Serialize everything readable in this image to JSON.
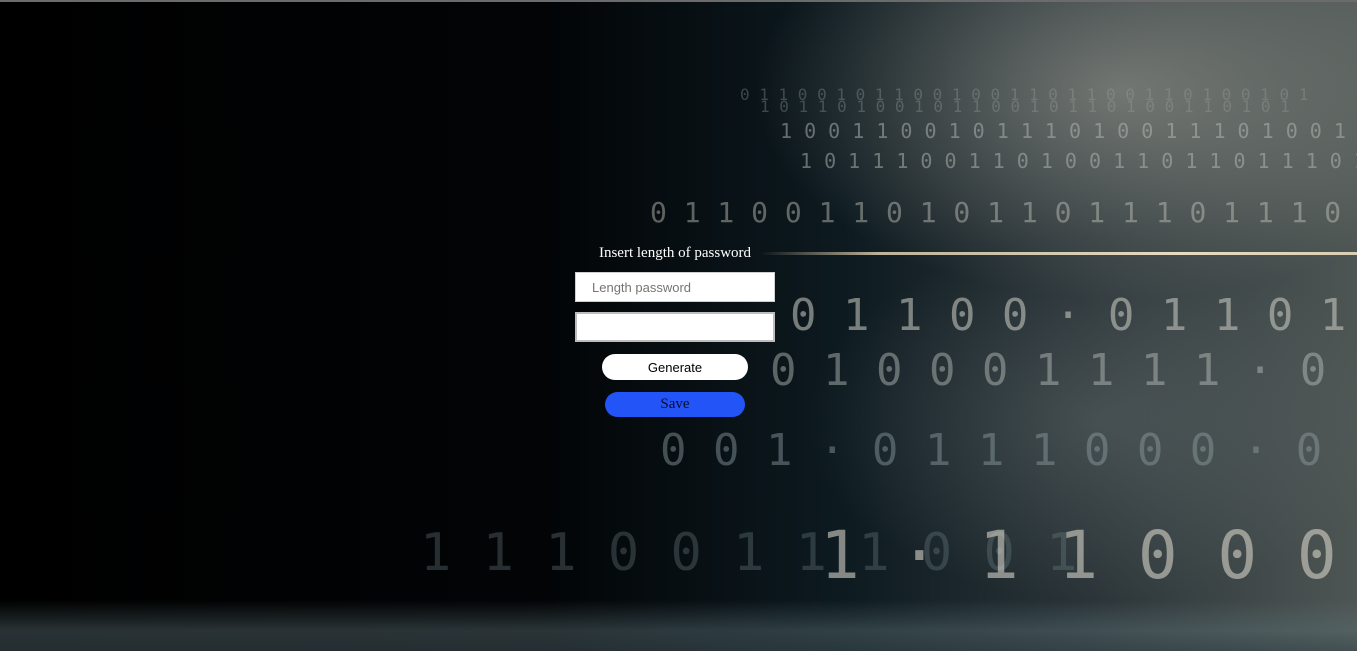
{
  "form": {
    "title": "Insert length of password",
    "length_placeholder": "Length password",
    "length_value": "",
    "result_value": "",
    "generate_label": "Generate",
    "save_label": "Save"
  },
  "colors": {
    "save_button": "#2354f7",
    "generate_button": "#ffffff",
    "background": "#000000"
  },
  "background_image": "binary-digits-tunnel"
}
